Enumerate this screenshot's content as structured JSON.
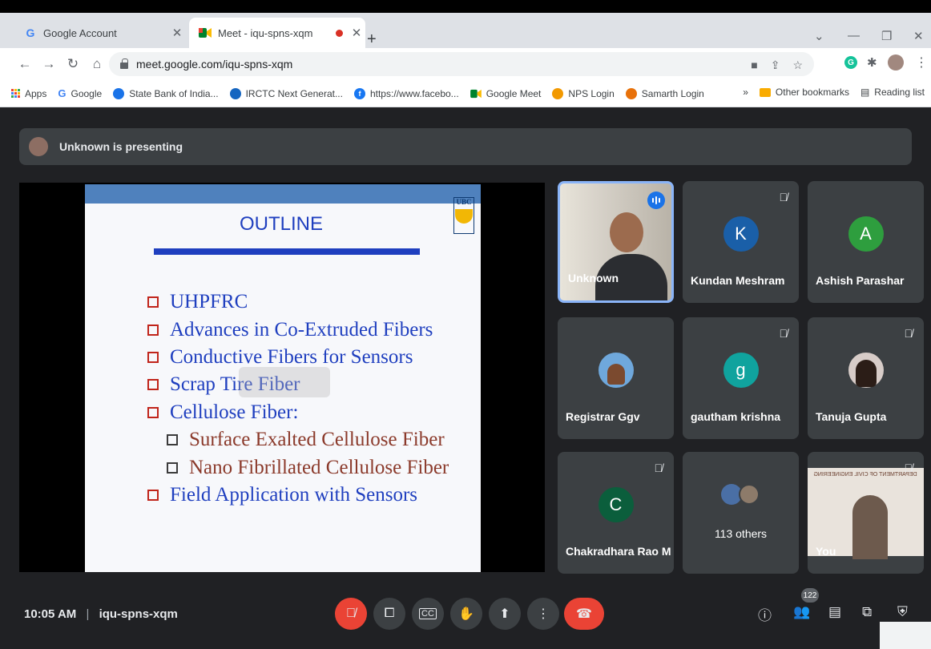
{
  "browser": {
    "tabs": [
      {
        "title": "Google Account",
        "favicon": "G"
      },
      {
        "title": "Meet - iqu-spns-xqm",
        "favicon": "meet-icon"
      }
    ],
    "url": "meet.google.com/iqu-spns-xqm",
    "bookmarks": [
      {
        "label": "Apps",
        "icon": "apps-grid-icon",
        "color": "#1a73e8"
      },
      {
        "label": "Google",
        "icon": "G",
        "color": "#4285f4"
      },
      {
        "label": "State Bank of India...",
        "icon": "sbi-icon",
        "color": "#1a73e8"
      },
      {
        "label": "IRCTC Next Generat...",
        "icon": "irctc-icon",
        "color": "#1565c0"
      },
      {
        "label": "https://www.facebo...",
        "icon": "facebook-icon",
        "color": "#1877f2"
      },
      {
        "label": "Google Meet",
        "icon": "meet-icon",
        "color": "#00832d"
      },
      {
        "label": "NPS Login",
        "icon": "nps-icon",
        "color": "#f29900"
      },
      {
        "label": "Samarth Login",
        "icon": "samarth-icon",
        "color": "#e8710a"
      }
    ],
    "other_bookmarks": "Other bookmarks",
    "reading_list": "Reading list"
  },
  "meet": {
    "presenting_text": "Unknown is presenting",
    "slide": {
      "logo_text": "UBC",
      "title": "OUTLINE",
      "bullets": [
        {
          "text": "UHPFRC",
          "level": 1
        },
        {
          "text": "Advances in Co-Extruded Fibers",
          "level": 1
        },
        {
          "text": "Conductive Fibers for Sensors",
          "level": 1
        },
        {
          "text": "Scrap Tire Fiber",
          "level": 1
        },
        {
          "text": "Cellulose Fiber:",
          "level": 1
        },
        {
          "text": "Surface Exalted Cellulose Fiber",
          "level": 2
        },
        {
          "text": "Nano Fibrillated Cellulose  Fiber",
          "level": 2
        },
        {
          "text": "Field Application with Sensors",
          "level": 1
        }
      ]
    },
    "participants": [
      {
        "name": "Unknown",
        "type": "video",
        "speaking": true
      },
      {
        "name": "Kundan Meshram",
        "initial": "K",
        "color": "#1a5fa8",
        "muted": true
      },
      {
        "name": "Ashish Parashar",
        "initial": "A",
        "color": "#2e9e3e",
        "muted": false
      },
      {
        "name": "Registrar Ggv",
        "type": "photo",
        "muted": false
      },
      {
        "name": "gautham krishna",
        "initial": "g",
        "color": "#10a39e",
        "muted": true
      },
      {
        "name": "Tanuja Gupta",
        "type": "photo",
        "muted": true
      },
      {
        "name": "Chakradhara Rao M",
        "initial": "C",
        "color": "#0b5e3c",
        "muted": true
      },
      {
        "name": "113 others",
        "type": "others"
      },
      {
        "name": "You",
        "type": "video",
        "muted": true
      }
    ],
    "you_banner": "DEPARTMENT OF CIVIL ENGINEERING",
    "time": "10:05 AM",
    "meeting_code": "iqu-spns-xqm",
    "participant_count": "122"
  }
}
